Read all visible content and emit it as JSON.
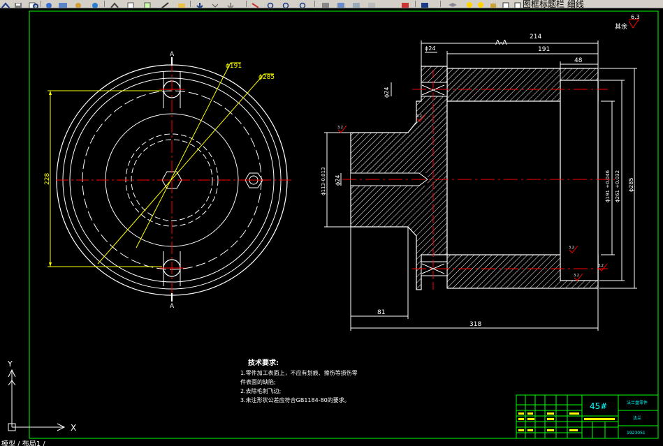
{
  "toolbar": {
    "layer_label": "图框标题栏 细线",
    "icons": [
      "draw-icon",
      "print-icon",
      "preview-icon",
      "publish-icon",
      "cut-icon",
      "copy-icon",
      "paste-icon",
      "brush-icon",
      "undo-icon",
      "redo-icon",
      "pan-icon",
      "zoom-realtime-icon",
      "zoom-window-icon",
      "zoom-previous-icon",
      "properties-icon",
      "design-center-icon",
      "tool-palette-icon",
      "sheet-set-icon",
      "markup-icon",
      "calculator-icon",
      "help-icon",
      "layer-manager-icon",
      "layer-bulb-icon",
      "layer-sun-icon",
      "layer-lock-icon",
      "layer-color-icon"
    ]
  },
  "colors": {
    "background": "#000000",
    "line_white": "#ffffff",
    "line_yellow": "#ffff00",
    "line_red": "#ff0000",
    "line_green": "#00ff00",
    "line_cyan": "#00ffff"
  },
  "drawing": {
    "section_label": "A-A",
    "cut_marks": [
      "A",
      "A"
    ],
    "front_view": {
      "dims": [
        "ϕ191",
        "ϕ285",
        "228"
      ]
    },
    "section_view": {
      "dims": [
        "214",
        "191",
        "48",
        "ϕ24",
        "ϕ24",
        "ϕ113-0.013",
        "ϕ191 +0.046",
        "ϕ261 +0.032",
        "ϕ285",
        "81",
        "318"
      ],
      "roughness": [
        "3.2",
        "3.2",
        "3.2",
        "3.2",
        "3.2"
      ]
    },
    "surface_finish": {
      "value": "6.3",
      "label": "其余"
    },
    "notes": {
      "title": "技术要求:",
      "lines": [
        "1.零件加工表面上，不应有划痕、擦伤等损伤零",
        "件表面的缺陷;",
        "2.去除毛刺飞边;",
        "3.未注形状公差应符合GB1184-80的要求。"
      ]
    },
    "title_block": {
      "material": "45#",
      "name": "法兰盘零件",
      "part": "法兰",
      "drawing_no": "1923051"
    },
    "ucs": {
      "y": "Y",
      "x": "X"
    }
  },
  "statusbar": {
    "text": "模型 / 布局1 /"
  }
}
